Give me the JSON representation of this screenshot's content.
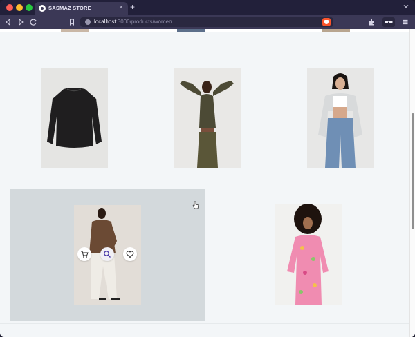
{
  "browser": {
    "tab_title": "SASMAZ STORE",
    "tab_close": "×",
    "new_tab": "+",
    "url_host": "localhost",
    "url_path": ":3000/products/women"
  },
  "icons": {
    "back": "chevron-left-icon",
    "forward": "chevron-right-icon",
    "reload": "reload-icon",
    "bookmark": "bookmark-icon",
    "site_info": "site-info-icon",
    "brave_shield": "brave-shield-icon",
    "extensions": "puzzle-icon",
    "profile": "glasses-icon",
    "menu": "menu-icon",
    "add_to_cart": "cart-icon",
    "quick_view": "search-icon",
    "wishlist": "heart-icon"
  },
  "colors": {
    "page_bg": "#f3f6f8",
    "hover_card_bg": "#d3d9dc",
    "browser_chrome": "#3b3856"
  },
  "products": [
    {
      "id": "p1",
      "description": "black knit sweater"
    },
    {
      "id": "p2",
      "description": "olive crop top and skirt set"
    },
    {
      "id": "p3",
      "description": "white cropped jacket with jeans"
    },
    {
      "id": "p4",
      "description": "brown satin shirt with white trousers",
      "hovered": true
    },
    {
      "id": "p5",
      "description": "pink floral shirt dress"
    }
  ]
}
